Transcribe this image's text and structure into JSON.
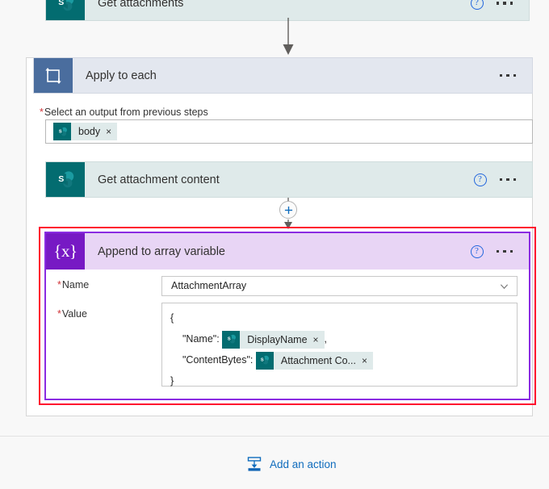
{
  "flow": {
    "steps": [
      {
        "id": "get-attachments",
        "title": "Get attachments",
        "icon": "sharepoint-icon",
        "help_label": "?",
        "more_label": "More commands"
      },
      {
        "id": "apply-to-each",
        "title": "Apply to each",
        "icon": "loop-icon",
        "more_label": "More commands",
        "field": {
          "required_marker": "*",
          "label": "Select an output from previous steps",
          "token": {
            "text": "body",
            "remove_label": "×",
            "icon": "sharepoint-icon"
          }
        },
        "children": [
          {
            "id": "get-attachment-content",
            "title": "Get attachment content",
            "icon": "sharepoint-icon",
            "help_label": "?",
            "more_label": "More commands"
          },
          {
            "id": "append-to-array-variable",
            "title": "Append to array variable",
            "icon": "variable-icon",
            "icon_glyph": "{x}",
            "help_label": "?",
            "more_label": "More commands",
            "highlighted": true,
            "fields": {
              "name": {
                "required_marker": "*",
                "label": "Name",
                "value": "AttachmentArray"
              },
              "value": {
                "required_marker": "*",
                "label": "Value",
                "lines": {
                  "open_brace": "{",
                  "name_key": "\"Name\":",
                  "name_token": "DisplayName",
                  "name_comma": ",",
                  "content_key": "\"ContentBytes\":",
                  "content_token": "Attachment Co...",
                  "close_brace": "}",
                  "remove_label": "×"
                }
              }
            }
          }
        ]
      }
    ],
    "insert_button_label": "+",
    "add_action": {
      "label": "Add an action",
      "icon": "add-action-icon"
    }
  },
  "colors": {
    "sharepoint_teal": "#036c70",
    "loop_blue": "#4a6d9e",
    "variable_purple": "#7719c4",
    "highlight_red": "#ff0d2e",
    "highlight_purple": "#8a2be2",
    "link_blue": "#0f6cbd",
    "action_bg": "#dfeaea",
    "scope_bg": "#e3e7ef",
    "variable_bg": "#e8d5f5"
  }
}
